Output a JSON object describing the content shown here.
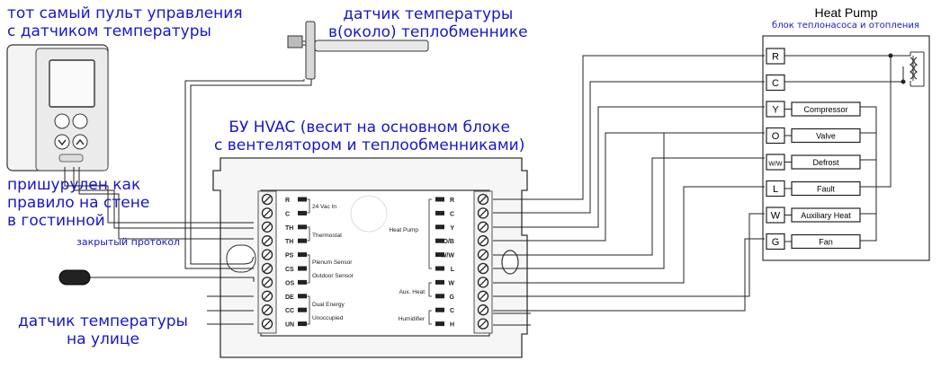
{
  "labels": {
    "remote": "тот самый пульт управления\nс датчиком температуры",
    "wall": "пришурулен как\nправило на стене\nв гостинной",
    "protocol": "закрытый протокол",
    "outdoor_sensor": "датчик температуры\nна улице",
    "hx_sensor": "датчик температуры\nв(около) теплобменнике",
    "hvac_module": "БУ HVAC (весит на основном блоке\nс вентелятором и теплообменниками)"
  },
  "heat_pump": {
    "title": "Heat Pump",
    "subtitle": "блок теплонасоса и отопления",
    "terminals": [
      {
        "code": "R",
        "function": ""
      },
      {
        "code": "C",
        "function": ""
      },
      {
        "code": "Y",
        "function": "Compressor"
      },
      {
        "code": "O",
        "function": "Valve"
      },
      {
        "code": "W/W",
        "function": "Defrost"
      },
      {
        "code": "L",
        "function": "Fault"
      },
      {
        "code": "W",
        "function": "Auxiliary Heat"
      },
      {
        "code": "G",
        "function": "Fan"
      }
    ]
  },
  "module": {
    "left_terminals": [
      "R",
      "C",
      "TH",
      "TH",
      "PS",
      "CS",
      "OS",
      "DE",
      "CC",
      "UN"
    ],
    "left_groups": [
      "24 Vac In",
      "Thermostat",
      "Plenum Sensor",
      "Outdoor Sensor",
      "Dual Energy",
      "Unoccupied"
    ],
    "right_terminals": [
      "R",
      "C",
      "Y",
      "O/B",
      "W/W",
      "L",
      "W",
      "G",
      "C",
      "H"
    ],
    "right_groups": [
      "Heat Pump",
      "Aux. Heat",
      "Humidifier"
    ]
  },
  "colors": {
    "label": "#1717c8",
    "line": "#222222"
  }
}
